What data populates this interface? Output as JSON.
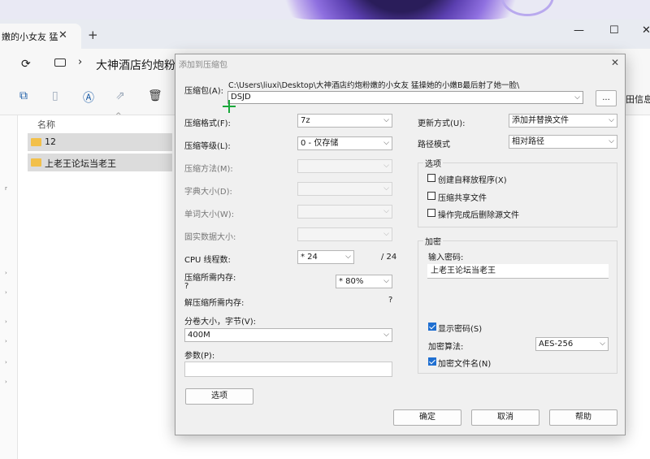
{
  "explorer": {
    "tab_title": "嫩的小女友 猛",
    "tab_close": "✕",
    "tab_add": "+",
    "window_controls": [
      "—",
      "☐",
      "✕"
    ],
    "address_path": "大神酒店约炮粉嫩的",
    "toolbar_right_label": "田信息",
    "column_name": "名称",
    "items": [
      {
        "label": "12"
      },
      {
        "label": "上老王论坛当老王"
      }
    ]
  },
  "dialog": {
    "title": "添加到压缩包",
    "archive_label": "压缩包(A):",
    "archive_path": "C:\\Users\\liuxi\\Desktop\\大神酒店约炮粉嫩的小女友 猛操她的小嫩B最后射了她一脸\\",
    "archive_name": "DSJD",
    "browse_button": "...",
    "left": {
      "format": {
        "label": "压缩格式(F):",
        "value": "7z"
      },
      "level": {
        "label": "压缩等级(L):",
        "value": "0 - 仅存储"
      },
      "method": {
        "label": "压缩方法(M):",
        "value": ""
      },
      "dict": {
        "label": "字典大小(D):",
        "value": ""
      },
      "word": {
        "label": "单词大小(W):",
        "value": ""
      },
      "solid": {
        "label": "固实数据大小:",
        "value": ""
      },
      "cpu": {
        "label": "CPU 线程数:",
        "value": "* 24",
        "total": "/ 24"
      },
      "mem_compress": {
        "label": "压缩所需内存:",
        "sub": "?",
        "value": "* 80%"
      },
      "mem_decompress": {
        "label": "解压缩所需内存:",
        "value": "?"
      },
      "split": {
        "label": "分卷大小，字节(V):",
        "value": "400M"
      },
      "params": {
        "label": "参数(P):",
        "value": ""
      },
      "options_button": "选项"
    },
    "right": {
      "update": {
        "label": "更新方式(U):",
        "value": "添加并替换文件"
      },
      "path_mode": {
        "label": "路径模式",
        "value": "相对路径"
      },
      "options_group": "选项",
      "options": [
        {
          "label": "创建自释放程序(X)",
          "checked": false
        },
        {
          "label": "压缩共享文件",
          "checked": false
        },
        {
          "label": "操作完成后删除源文件",
          "checked": false
        }
      ],
      "encryption_group": "加密",
      "password_label": "输入密码:",
      "password_value": "上老王论坛当老王",
      "show_password": {
        "label": "显示密码(S)",
        "checked": true
      },
      "algorithm": {
        "label": "加密算法:",
        "value": "AES-256"
      },
      "encrypt_names": {
        "label": "加密文件名(N)",
        "checked": true
      }
    },
    "ok": "确定",
    "cancel": "取消",
    "help": "帮助"
  },
  "colors": {
    "accent": "#1f6fd1",
    "folder": "#f2c04a",
    "cursor": "#18a83a"
  }
}
